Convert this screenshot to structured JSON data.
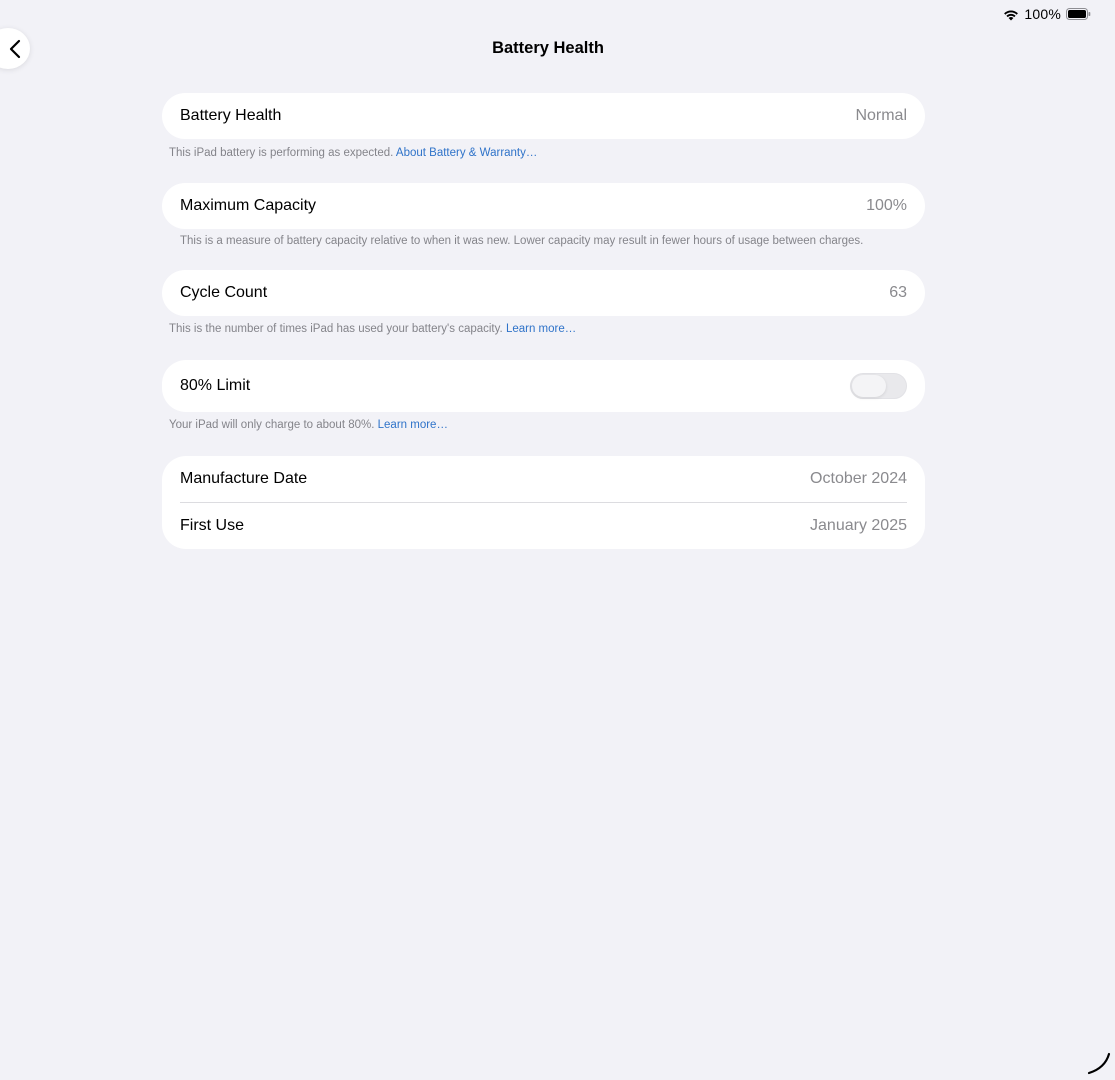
{
  "status_bar": {
    "battery_percent": "100%",
    "battery_level": 1.0,
    "wifi_icon": "wifi-icon",
    "battery_icon": "battery-full-icon"
  },
  "nav": {
    "back_icon": "chevron-left-icon",
    "title": "Battery Health"
  },
  "battery_health": {
    "label": "Battery Health",
    "value": "Normal",
    "footnote": "This iPad battery is performing as expected.",
    "link": "About Battery & Warranty…"
  },
  "maximum_capacity": {
    "label": "Maximum Capacity",
    "value": "100%",
    "footnote": "This is a measure of battery capacity relative to when it was new. Lower capacity may result in fewer hours of usage between charges."
  },
  "cycle_count": {
    "label": "Cycle Count",
    "value": "63",
    "footnote": "This is the number of times iPad has used your battery's capacity.",
    "link": "Learn more…"
  },
  "limit_80": {
    "label": "80% Limit",
    "enabled": false,
    "footnote": "Your iPad will only charge to about 80%.",
    "link": "Learn more…"
  },
  "dates": {
    "manufacture_label": "Manufacture Date",
    "manufacture_value": "October 2024",
    "first_use_label": "First Use",
    "first_use_value": "January 2025"
  },
  "colors": {
    "background": "#f2f2f7",
    "card": "#ffffff",
    "link": "#2f73c9",
    "secondary_text": "#8a8a8e"
  }
}
